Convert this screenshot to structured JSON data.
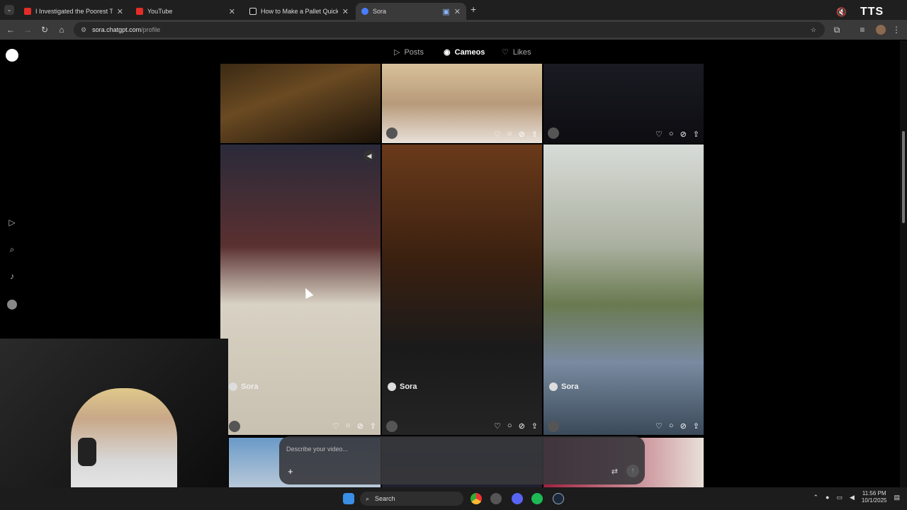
{
  "browser": {
    "tabs": [
      {
        "title": "I Investigated the Poorest Town",
        "fav_color": "#e52d27"
      },
      {
        "title": "YouTube",
        "fav_color": "#e52d27"
      },
      {
        "title": "How to Make a Pallet Quickly a",
        "fav_color": "#ffffff"
      },
      {
        "title": "Sora",
        "fav_color": "#4a7cff"
      }
    ],
    "url_host": "sora.chatgpt.com",
    "url_path": "/profile"
  },
  "overlay": {
    "tts": "TTS"
  },
  "profile": {
    "tabs": [
      "Posts",
      "Cameos",
      "Likes"
    ],
    "active_tab": "Cameos"
  },
  "tiles": {
    "creator": "Sora"
  },
  "composer": {
    "placeholder": "Describe your video..."
  },
  "taskbar": {
    "search": "Search",
    "time": "11:56 PM",
    "date": "10/1/2025"
  }
}
